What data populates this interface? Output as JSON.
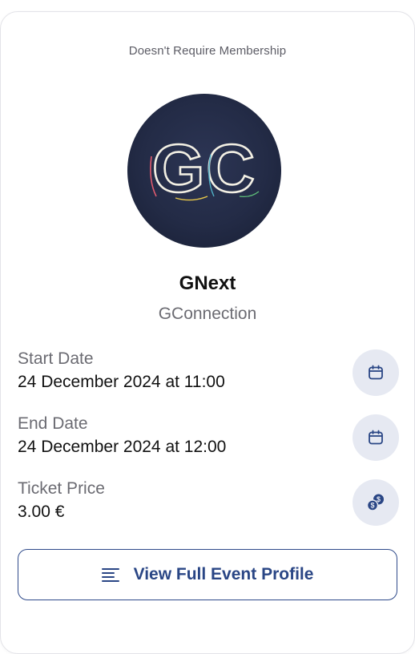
{
  "membership_note": "Doesn't Require Membership",
  "event": {
    "logo_text": "GC",
    "title": "GNext",
    "organizer": "GConnection"
  },
  "details": [
    {
      "label": "Start Date",
      "value": "24 December 2024 at 11:00",
      "icon": "calendar-icon"
    },
    {
      "label": "End Date",
      "value": "24 December 2024 at 12:00",
      "icon": "calendar-icon"
    },
    {
      "label": "Ticket Price",
      "value": "3.00 €",
      "icon": "coins-icon"
    }
  ],
  "cta": {
    "label": "View Full Event Profile",
    "icon": "list-icon"
  },
  "colors": {
    "accent": "#2a4685",
    "icon_bg": "#e6e9f2",
    "avatar_bg": "#232b46"
  }
}
